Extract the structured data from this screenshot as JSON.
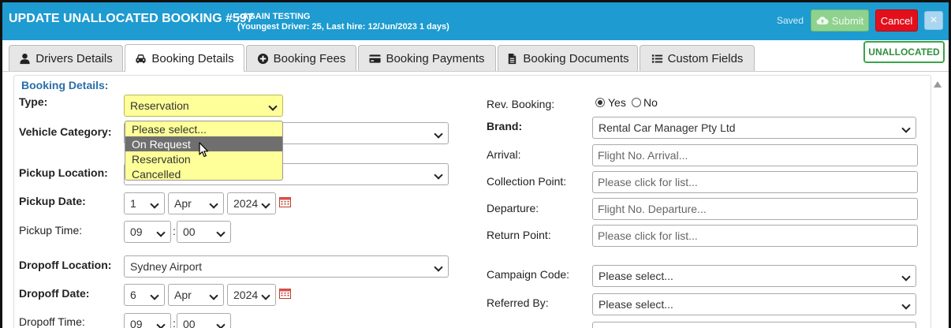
{
  "header": {
    "title": "UPDATE UNALLOCATED BOOKING #597",
    "subtitle_line1": "- AGAIN TESTING",
    "subtitle_line2": "(Youngest Driver: 25, Last hire: 12/Jun/2023 1 days)",
    "saved": "Saved",
    "submit": "Submit",
    "cancel": "Cancel",
    "close": "×",
    "colors": {
      "bar": "#1e9bd0",
      "cancel": "#e3101c",
      "submit": "#8fd18f"
    }
  },
  "tabs": [
    {
      "label": "Drivers Details",
      "icon": "user-icon"
    },
    {
      "label": "Booking Details",
      "icon": "car-icon",
      "active": true
    },
    {
      "label": "Booking Fees",
      "icon": "plus-circle-icon"
    },
    {
      "label": "Booking Payments",
      "icon": "credit-card-icon"
    },
    {
      "label": "Booking Documents",
      "icon": "file-icon"
    },
    {
      "label": "Custom Fields",
      "icon": "list-icon"
    }
  ],
  "status_badge": "UNALLOCATED",
  "section_heading": "Booking Details:",
  "left": {
    "type_label": "Type:",
    "type_value": "Reservation",
    "type_options": [
      "Please select...",
      "On Request",
      "Reservation",
      "Cancelled"
    ],
    "type_highlighted": "On Request",
    "vehicle_category_label": "Vehicle Category:",
    "pickup_location_label": "Pickup Location:",
    "pickup_date_label": "Pickup Date:",
    "pickup_day": "1",
    "pickup_month": "Apr",
    "pickup_year": "2024",
    "pickup_time_label": "Pickup Time:",
    "pickup_hour": "09",
    "pickup_minute": "00",
    "dropoff_location_label": "Dropoff Location:",
    "dropoff_location_value": "Sydney Airport",
    "dropoff_date_label": "Dropoff Date:",
    "dropoff_day": "6",
    "dropoff_month": "Apr",
    "dropoff_year": "2024",
    "dropoff_time_label": "Dropoff Time:",
    "dropoff_hour": "09",
    "dropoff_minute": "00",
    "colon": ":"
  },
  "right": {
    "rev_booking_label": "Rev. Booking:",
    "rev_yes": "Yes",
    "rev_no": "No",
    "brand_label": "Brand:",
    "brand_value": "Rental Car Manager Pty Ltd",
    "arrival_label": "Arrival:",
    "arrival_placeholder": "Flight No. Arrival...",
    "collection_label": "Collection Point:",
    "collection_placeholder": "Please click for list...",
    "departure_label": "Departure:",
    "departure_placeholder": "Flight No. Departure...",
    "return_label": "Return Point:",
    "return_placeholder": "Please click for list...",
    "campaign_label": "Campaign Code:",
    "campaign_value": "Please select...",
    "referred_label": "Referred By:",
    "referred_value": "Please select..."
  }
}
